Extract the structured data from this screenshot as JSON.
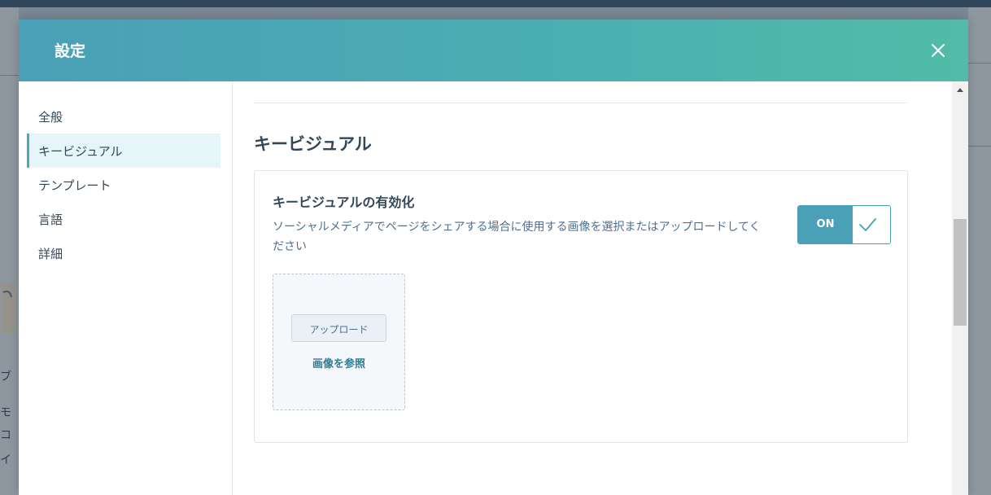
{
  "modal": {
    "title": "設定"
  },
  "sidebar": {
    "items": [
      {
        "label": "全般",
        "active": false
      },
      {
        "label": "キービジュアル",
        "active": true
      },
      {
        "label": "テンプレート",
        "active": false
      },
      {
        "label": "言語",
        "active": false
      },
      {
        "label": "詳細",
        "active": false
      }
    ]
  },
  "content": {
    "section_title": "キービジュアル",
    "card": {
      "title": "キービジュアルの有効化",
      "description": "ソーシャルメディアでページをシェアする場合に使用する画像を選択またはアップロードしてください",
      "toggle": {
        "state_label": "ON",
        "enabled": true
      },
      "upload": {
        "button_label": "アップロード",
        "browse_label": "画像を参照"
      }
    }
  },
  "background": {
    "left_fragments": [
      "ブ",
      "モ",
      "コ",
      "イ"
    ]
  },
  "icons": {
    "close": "close-icon",
    "check": "checkmark-icon",
    "scroll_up": "arrow-up-icon"
  },
  "colors": {
    "header_start": "#4aa0b6",
    "header_end": "#53bba7",
    "accent": "#4aa0b6",
    "link": "#2e7d95",
    "text": "#33475b"
  }
}
